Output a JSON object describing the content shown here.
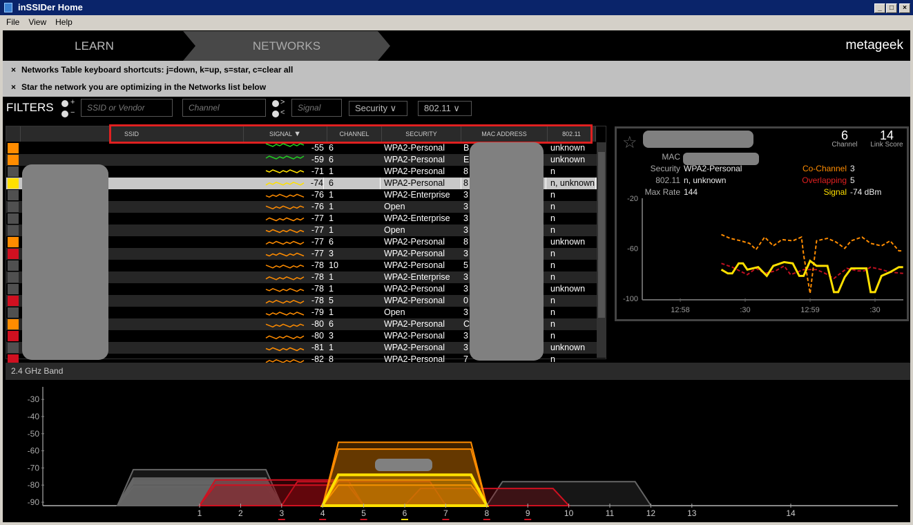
{
  "window": {
    "title": "inSSIDer Home",
    "buttons": [
      "_",
      "□",
      "×"
    ]
  },
  "menu": [
    "File",
    "View",
    "Help"
  ],
  "nav": {
    "learn": "LEARN",
    "networks": "NETWORKS",
    "logo": "metageek"
  },
  "tips": [
    {
      "close": "×",
      "text": "Networks Table keyboard shortcuts: j=down, k=up, s=star, c=clear all"
    },
    {
      "close": "×",
      "text": "Star the network you are optimizing in the Networks list below"
    }
  ],
  "filters": {
    "label": "FILTERS",
    "plus": "+",
    "minus": "−",
    "gt": ">",
    "lt": "<",
    "ssid_placeholder": "SSID or Vendor",
    "channel_placeholder": "Channel",
    "signal_placeholder": "Signal",
    "security": "Security ∨",
    "phy": "802.11 ∨"
  },
  "colors": {
    "orange": "#ff8c00",
    "yellow": "#ffe000",
    "red": "#d01020",
    "gray": "#505050",
    "green": "#22cc22"
  },
  "table": {
    "headers": {
      "ssid": "SSID",
      "signal": "SIGNAL",
      "sort_icon": "▼",
      "channel": "CHANNEL",
      "security": "SECURITY",
      "mac": "MAC ADDRESS",
      "phy": "802.11"
    },
    "rows": [
      {
        "color": "orange",
        "spark": "green",
        "signal": "-55",
        "channel": "6",
        "security": "WPA2-Personal",
        "mac": "B",
        "phy": "unknown"
      },
      {
        "color": "orange",
        "spark": "green",
        "signal": "-59",
        "channel": "6",
        "security": "WPA2-Personal",
        "mac": "E",
        "phy": "unknown"
      },
      {
        "color": "gray",
        "spark": "yellow",
        "signal": "-71",
        "channel": "1",
        "security": "WPA2-Personal",
        "mac": "8",
        "phy": "n"
      },
      {
        "color": "yellow",
        "spark": "yellow",
        "signal": "-74",
        "channel": "6",
        "security": "WPA2-Personal",
        "mac": "8",
        "phy": "n, unknown",
        "selected": true
      },
      {
        "color": "gray",
        "spark": "orange",
        "signal": "-76",
        "channel": "1",
        "security": "WPA2-Enterprise",
        "mac": "3",
        "phy": "n"
      },
      {
        "color": "gray",
        "spark": "orange",
        "signal": "-76",
        "channel": "1",
        "security": "Open",
        "mac": "3",
        "phy": "n"
      },
      {
        "color": "gray",
        "spark": "orange",
        "signal": "-77",
        "channel": "1",
        "security": "WPA2-Enterprise",
        "mac": "3",
        "phy": "n"
      },
      {
        "color": "gray",
        "spark": "orange",
        "signal": "-77",
        "channel": "1",
        "security": "Open",
        "mac": "3",
        "phy": "n"
      },
      {
        "color": "orange",
        "spark": "orange",
        "signal": "-77",
        "channel": "6",
        "security": "WPA2-Personal",
        "mac": "8",
        "phy": "unknown"
      },
      {
        "color": "red",
        "spark": "orange",
        "signal": "-77",
        "channel": "3",
        "security": "WPA2-Personal",
        "mac": "3",
        "phy": "n"
      },
      {
        "color": "gray",
        "spark": "orange",
        "signal": "-78",
        "channel": "10",
        "security": "WPA2-Personal",
        "mac": "5",
        "phy": "n"
      },
      {
        "color": "gray",
        "spark": "orange",
        "signal": "-78",
        "channel": "1",
        "security": "WPA2-Enterprise",
        "mac": "3",
        "phy": "n"
      },
      {
        "color": "gray",
        "spark": "orange",
        "signal": "-78",
        "channel": "1",
        "security": "WPA2-Personal",
        "mac": "3",
        "phy": "unknown"
      },
      {
        "color": "red",
        "spark": "orange",
        "signal": "-78",
        "channel": "5",
        "security": "WPA2-Personal",
        "mac": "0",
        "phy": "n"
      },
      {
        "color": "gray",
        "spark": "orange",
        "signal": "-79",
        "channel": "1",
        "security": "Open",
        "mac": "3",
        "phy": "n"
      },
      {
        "color": "orange",
        "spark": "orange",
        "signal": "-80",
        "channel": "6",
        "security": "WPA2-Personal",
        "mac": "C",
        "phy": "n"
      },
      {
        "color": "red",
        "spark": "orange",
        "signal": "-80",
        "channel": "3",
        "security": "WPA2-Personal",
        "mac": "3",
        "phy": "n"
      },
      {
        "color": "gray",
        "spark": "orange",
        "signal": "-81",
        "channel": "1",
        "security": "WPA2-Personal",
        "mac": "3",
        "phy": "unknown"
      },
      {
        "color": "red",
        "spark": "orange",
        "signal": "-82",
        "channel": "8",
        "security": "WPA2-Personal",
        "mac": "7",
        "phy": "n"
      }
    ]
  },
  "details": {
    "star_icon": "☆",
    "channel": "6",
    "channel_label": "Channel",
    "link_score": "14",
    "link_score_label": "Link Score",
    "mac_label": "MAC",
    "security_label": "Security",
    "security": "WPA2-Personal",
    "phy_label": "802.11",
    "phy": "n, unknown",
    "rate_label": "Max Rate",
    "rate": "144",
    "cochannel_label": "Co-Channel",
    "cochannel": "3",
    "overlap_label": "Overlapping",
    "overlap": "5",
    "signal_label": "Signal",
    "signal": "-74 dBm"
  },
  "chart_data": [
    {
      "type": "line",
      "ylim": [
        -100,
        -20
      ],
      "yticks": [
        "-20",
        "-60",
        "-100"
      ],
      "xticks": [
        "12:58",
        ":30",
        "12:59",
        ":30"
      ],
      "series": [
        {
          "name": "Co-Channel",
          "color": "#ff8c00",
          "dashed": true,
          "points": [
            [
              "12:58:19",
              -49
            ],
            [
              "12:58:23",
              -52
            ],
            [
              "12:58:28",
              -54
            ],
            [
              "12:58:32",
              -56
            ],
            [
              "12:58:35",
              -61
            ],
            [
              "12:58:39",
              -51
            ],
            [
              "12:58:43",
              -58
            ],
            [
              "12:58:47",
              -53
            ],
            [
              "12:58:52",
              -54
            ],
            [
              "12:58:56",
              -51
            ],
            [
              "12:58:57",
              -65
            ],
            [
              "12:59:00",
              -96
            ],
            [
              "12:59:03",
              -54
            ],
            [
              "12:59:08",
              -52
            ],
            [
              "12:59:12",
              -55
            ],
            [
              "12:59:16",
              -60
            ],
            [
              "12:59:19",
              -54
            ],
            [
              "12:59:24",
              -51
            ],
            [
              "12:59:28",
              -56
            ],
            [
              "12:59:33",
              -58
            ],
            [
              "12:59:37",
              -54
            ],
            [
              "12:59:41",
              -62
            ],
            [
              "12:59:43",
              -62
            ]
          ]
        },
        {
          "name": "Overlapping",
          "color": "#c01020",
          "dashed": true,
          "points": [
            [
              "12:58:19",
              -72
            ],
            [
              "12:58:24",
              -75
            ],
            [
              "12:58:31",
              -81
            ],
            [
              "12:58:35",
              -76
            ],
            [
              "12:58:39",
              -80
            ],
            [
              "12:58:44",
              -78
            ],
            [
              "12:58:48",
              -74
            ],
            [
              "12:58:51",
              -81
            ],
            [
              "12:58:57",
              -77
            ],
            [
              "12:59:03",
              -77
            ],
            [
              "12:59:07",
              -80
            ],
            [
              "12:59:11",
              -84
            ],
            [
              "12:59:17",
              -76
            ],
            [
              "12:59:22",
              -78
            ],
            [
              "12:59:25",
              -78
            ],
            [
              "12:59:28",
              -75
            ],
            [
              "12:59:33",
              -77
            ],
            [
              "12:59:37",
              -79
            ],
            [
              "12:59:43",
              -80
            ]
          ]
        },
        {
          "name": "Signal",
          "color": "#ffe000",
          "dashed": false,
          "points": [
            [
              "12:58:19",
              -77
            ],
            [
              "12:58:22",
              -80
            ],
            [
              "12:58:24",
              -80
            ],
            [
              "12:58:27",
              -72
            ],
            [
              "12:58:29",
              -72
            ],
            [
              "12:58:31",
              -77
            ],
            [
              "12:58:36",
              -75
            ],
            [
              "12:58:40",
              -82
            ],
            [
              "12:58:43",
              -74
            ],
            [
              "12:58:48",
              -71
            ],
            [
              "12:58:52",
              -72
            ],
            [
              "12:58:55",
              -82
            ],
            [
              "12:58:57",
              -82
            ],
            [
              "12:59:00",
              -70
            ],
            [
              "12:59:03",
              -74
            ],
            [
              "12:59:08",
              -74
            ],
            [
              "12:59:11",
              -95
            ],
            [
              "12:59:13",
              -95
            ],
            [
              "12:59:16",
              -83
            ],
            [
              "12:59:19",
              -76
            ],
            [
              "12:59:26",
              -76
            ],
            [
              "12:59:28",
              -95
            ],
            [
              "12:59:30",
              -95
            ],
            [
              "12:59:33",
              -82
            ],
            [
              "12:59:37",
              -79
            ],
            [
              "12:59:41",
              -75
            ],
            [
              "12:59:43",
              -75
            ]
          ]
        }
      ]
    },
    {
      "type": "area",
      "title": "2.4 GHz Band",
      "yticks": [
        "-30",
        "-40",
        "-50",
        "-60",
        "-70",
        "-80",
        "-90"
      ],
      "ylim": [
        -92,
        -25
      ],
      "channels": [
        "1",
        "2",
        "3",
        "4",
        "5",
        "6",
        "7",
        "8",
        "9",
        "10",
        "11",
        "12",
        "13",
        "14"
      ],
      "channel_marks": {
        "3": "red",
        "4": "red",
        "5": "red",
        "6": "yellow",
        "7": "red",
        "8": "red",
        "9": "red"
      }
    }
  ]
}
